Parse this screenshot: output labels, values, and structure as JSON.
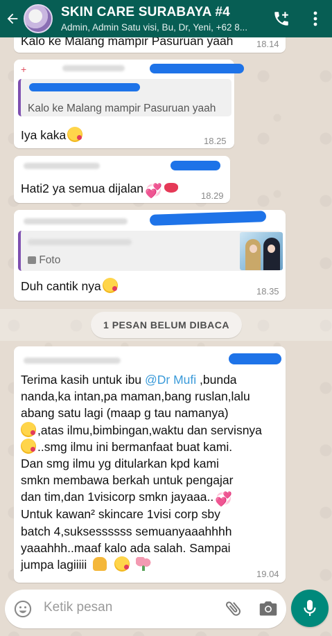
{
  "header": {
    "title": "SKIN CARE SURABAYA #4",
    "subtitle": "Admin, Admin Satu visi, Bu, Dr, Yeni, +62 8..."
  },
  "messages": {
    "m0": {
      "text": "Kalo ke Malang mampir Pasuruan yaah",
      "time": "18.14"
    },
    "m1": {
      "quote": "Kalo ke Malang mampir Pasuruan yaah",
      "text": "Iya kaka",
      "time": "18.25"
    },
    "m2": {
      "text": "Hati2 ya semua dijalan",
      "time": "18.29"
    },
    "m3": {
      "quote_label": "Foto",
      "text": "Duh cantik nya",
      "time": "18.35"
    },
    "m4": {
      "line1": "Terima kasih untuk ibu ",
      "mention": "@Dr Mufi",
      "line1b": " ,bunda",
      "line2": "nanda,ka intan,pa maman,bang ruslan,lalu",
      "line3": "abang satu lagi (maap g tau namanya)",
      "line4": ",atas ilmu,bimbingan,waktu dan servisnya",
      "line5": "..smg ilmu ini bermanfaat buat kami.",
      "line6": "Dan smg ilmu yg ditularkan kpd kami",
      "line7": "smkn membawa berkah untuk pengajar",
      "line8": "dan tim,dan 1visicorp smkn jayaaa..",
      "line9": "Untuk kawan² skincare 1visi corp sby",
      "line10": "batch 4,suksessssss semuanyaaahhhh",
      "line11": "yaaahhh..maaf kalo ada salah. Sampai",
      "line12": "jumpa lagiiiii",
      "time": "19.04"
    }
  },
  "unread_label": "1 PESAN BELUM DIBACA",
  "input": {
    "placeholder": "Ketik pesan"
  },
  "colors": {
    "header": "#075e54",
    "accent": "#00897b",
    "mention": "#3a9ad9"
  }
}
